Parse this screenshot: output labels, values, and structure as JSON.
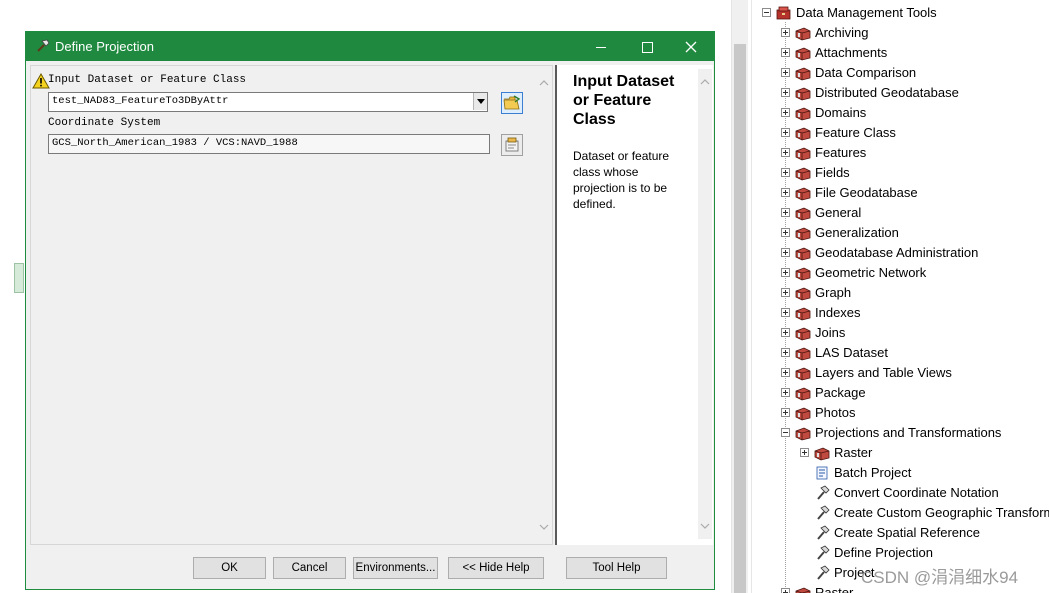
{
  "dialog": {
    "title": "Define Projection",
    "input_label": "Input Dataset or Feature Class",
    "input_value": "test_NAD83_FeatureTo3DByAttr",
    "coord_label": "Coordinate System",
    "coord_value": "GCS_North_American_1983 / VCS:NAVD_1988",
    "help_title": "Input Dataset or Feature Class",
    "help_text": "Dataset or feature class whose projection is to be defined.",
    "buttons": {
      "ok": "OK",
      "cancel": "Cancel",
      "environments": "Environments...",
      "hide_help": "<< Hide Help",
      "tool_help": "Tool Help"
    },
    "colors": {
      "titlebar": "#1f8a3f"
    }
  },
  "tree": {
    "root": "Data Management Tools",
    "items": [
      "Archiving",
      "Attachments",
      "Data Comparison",
      "Distributed Geodatabase",
      "Domains",
      "Feature Class",
      "Features",
      "Fields",
      "File Geodatabase",
      "General",
      "Generalization",
      "Geodatabase Administration",
      "Geometric Network",
      "Graph",
      "Indexes",
      "Joins",
      "LAS Dataset",
      "Layers and Table Views",
      "Package",
      "Photos",
      "Projections and Transformations"
    ],
    "sub_toolset": "Raster",
    "tools": [
      "Batch Project",
      "Convert Coordinate Notation",
      "Create Custom Geographic Transformation",
      "Create Spatial Reference",
      "Define Projection",
      "Project"
    ],
    "next": "Raster"
  },
  "watermark": "CSDN @涓涓细水94"
}
